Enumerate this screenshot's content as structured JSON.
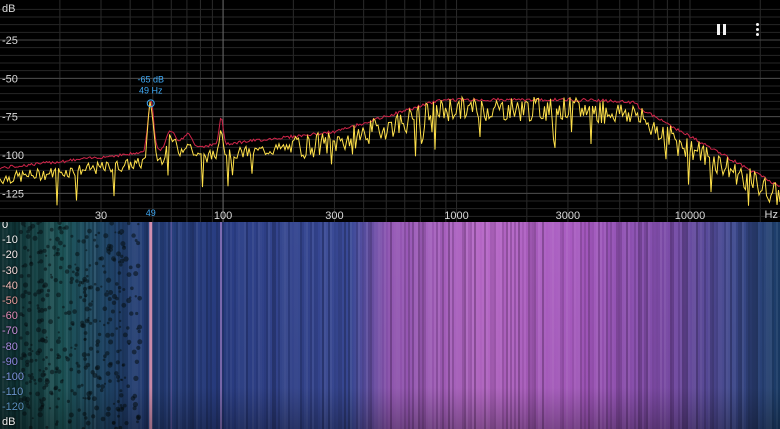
{
  "spectrum": {
    "y_unit": "dB",
    "y_ticks": [
      {
        "label": "-25",
        "value": -25
      },
      {
        "label": "-50",
        "value": -50
      },
      {
        "label": "-75",
        "value": -75
      },
      {
        "label": "-100",
        "value": -100
      },
      {
        "label": "-125",
        "value": -125
      }
    ],
    "x_unit": "Hz",
    "x_ticks": [
      {
        "label": "30",
        "value": 30
      },
      {
        "label": "100",
        "value": 100
      },
      {
        "label": "300",
        "value": 300
      },
      {
        "label": "1000",
        "value": 1000
      },
      {
        "label": "3000",
        "value": 3000
      },
      {
        "label": "10000",
        "value": 10000
      }
    ],
    "peak_marker": {
      "freq_label": "49",
      "db_text": "-65 dB",
      "hz_text": "49 Hz",
      "freq": 49,
      "db": -65
    },
    "colors": {
      "peak_hold": "#d0254a",
      "live": "#ffe14a",
      "marker": "#3fa9f5",
      "grid": "#3a3a3a"
    }
  },
  "toolbar": {
    "pause_icon": "pause-icon",
    "more_icon": "more-vert-icon"
  },
  "spectrogram": {
    "levels": [
      {
        "label": "0",
        "color": "#ffffff"
      },
      {
        "label": "-10",
        "color": "#f0f0f0"
      },
      {
        "label": "-20",
        "color": "#f4e8e8"
      },
      {
        "label": "-30",
        "color": "#f5d6d6"
      },
      {
        "label": "-40",
        "color": "#f1b9b6"
      },
      {
        "label": "-50",
        "color": "#e89a9a"
      },
      {
        "label": "-60",
        "color": "#e088b4"
      },
      {
        "label": "-70",
        "color": "#c98ed8"
      },
      {
        "label": "-80",
        "color": "#a98ae0"
      },
      {
        "label": "-90",
        "color": "#8d86e0"
      },
      {
        "label": "-100",
        "color": "#7c93dc"
      },
      {
        "label": "-110",
        "color": "#6a95cc"
      },
      {
        "label": "-120",
        "color": "#5a8fbe"
      }
    ],
    "unit": "dB",
    "colors": {
      "dark": "#0a2a2e",
      "teal": "#1f5a60",
      "blue": "#394a96",
      "purple": "#9a5ab8",
      "magenta": "#c070d0"
    }
  }
}
